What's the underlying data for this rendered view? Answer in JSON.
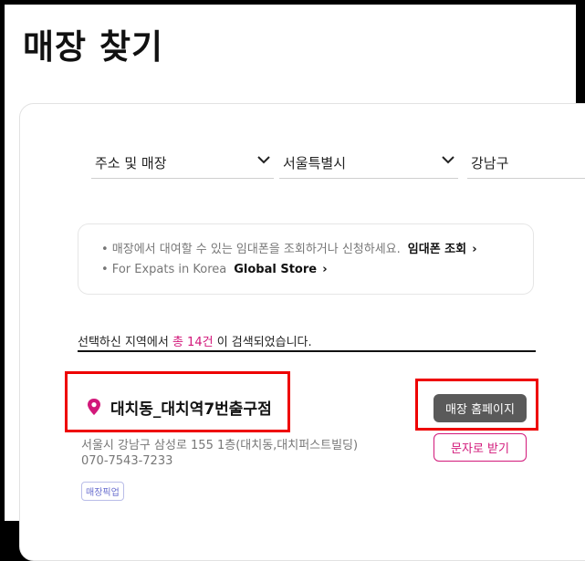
{
  "page": {
    "title": "매장 찾기"
  },
  "filters": {
    "type": {
      "value": "주소 및 매장"
    },
    "city": {
      "value": "서울특별시"
    },
    "district": {
      "value": "강남구"
    }
  },
  "notice": {
    "rental_text": "• 매장에서 대여할 수 있는 임대폰을 조회하거나 신청하세요.",
    "rental_link": "임대폰 조회",
    "expats_text": "• For Expats in Korea",
    "expats_link": "Global Store",
    "arrow": "›"
  },
  "result": {
    "prefix": "선택하신 지역에서 ",
    "count": "총 14건",
    "suffix": " 이 검색되었습니다."
  },
  "store": {
    "name": "대치동_대치역7번출구점",
    "address": "서울시 강남구 삼성로 155 1층(대치동,대치퍼스트빌딩)",
    "phone": "070-7543-7233",
    "tag": "매장픽업",
    "home_button": "매장 홈페이지",
    "sms_button": "문자로 받기"
  },
  "colors": {
    "accent": "#d2187a",
    "highlight": "#e00000",
    "button_dark": "#5a5a5a"
  }
}
